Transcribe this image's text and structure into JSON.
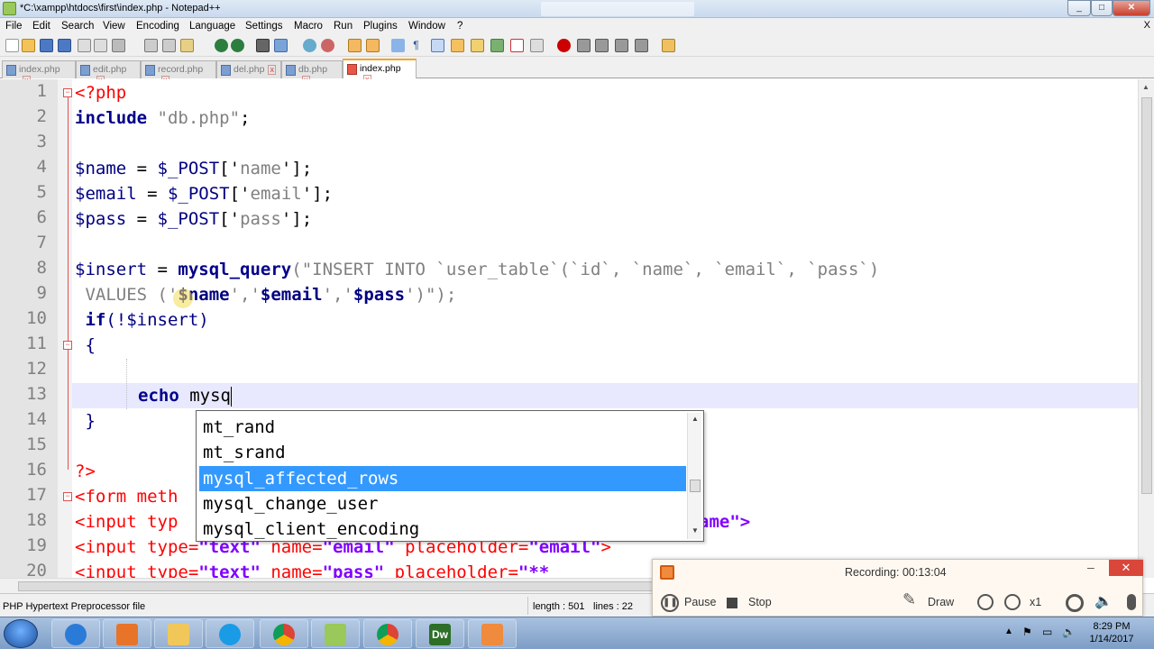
{
  "window": {
    "title": "*C:\\xampp\\htdocs\\first\\index.php - Notepad++",
    "min_label": "_",
    "max_label": "□",
    "close_label": "✕"
  },
  "menu": [
    "File",
    "Edit",
    "Search",
    "View",
    "Encoding",
    "Language",
    "Settings",
    "Macro",
    "Run",
    "Plugins",
    "Window",
    "?"
  ],
  "menu_close": "X",
  "tabs": [
    {
      "label": "index.php"
    },
    {
      "label": "edit.php"
    },
    {
      "label": "record.php"
    },
    {
      "label": "del.php"
    },
    {
      "label": "db.php"
    },
    {
      "label": "index.php",
      "active": true
    }
  ],
  "tab_close": "x",
  "editor": {
    "line_numbers": [
      "1",
      "2",
      "3",
      "4",
      "5",
      "6",
      "7",
      "8",
      "9",
      "10",
      "11",
      "12",
      "13",
      "14",
      "15",
      "16",
      "17",
      "18",
      "19",
      "20"
    ],
    "lines": {
      "l1": "<?php",
      "l2_kw": "include",
      "l2_str": " \"db.php\"",
      "l2_end": ";",
      "l4_var": "$name",
      "l4_op": " = ",
      "l4_post": "$_POST",
      "l4_idx": "['",
      "l4_key": "name",
      "l4_end": "'];",
      "l5_var": "$email",
      "l5_key": "email",
      "l6_var": "$pass",
      "l6_key": "pass",
      "l8_var": "$insert",
      "l8_fn": "mysql_query",
      "l8_str": "(\"INSERT INTO `user_table`(`id`, `name`, `email`, `pass`)",
      "l9_str": " VALUES ('",
      "l9_v1": "$name",
      "l9_s2": "','",
      "l9_v2": "$email",
      "l9_v3": "$pass",
      "l9_end": "')\");",
      "l10_kw": " if",
      "l10_rest": "(!$insert)",
      "l11": " {",
      "l13_kw": "echo",
      "l13_rest": " mysq",
      "l14": " }",
      "l16": "?>",
      "l17_tag": "<form",
      "l17_attr": " meth",
      "l18_tag": "<input",
      "l18_attr": " typ",
      "l18_tail": "ame\">",
      "l19_tag": "<input",
      "l19_a1": " type=",
      "l19_v1": "\"text\"",
      "l19_a2": " name=",
      "l19_v2": "\"email\"",
      "l19_a3": " placeholder=",
      "l19_v3": "\"email\"",
      "l19_end": ">",
      "l20_tag": "<input",
      "l20_a1": " type=",
      "l20_v1": "\"text\"",
      "l20_a2": " name=",
      "l20_v2": "\"pass\"",
      "l20_a3": " placeholder=",
      "l20_v3": "\"**"
    }
  },
  "autocomplete": {
    "items": [
      "mt_rand",
      "mt_srand",
      "mysql_affected_rows",
      "mysql_change_user",
      "mysql_client_encoding"
    ],
    "selected_index": 2
  },
  "status": {
    "filetype": "PHP Hypertext Preprocessor file",
    "length": "length : 501",
    "lines": "lines : 22"
  },
  "recorder": {
    "label": "Recording:",
    "time": "00:13:04",
    "pause": "Pause",
    "stop": "Stop",
    "draw": "Draw",
    "zoom": "x1",
    "min_label": "–",
    "close_label": "✕"
  },
  "taskbar": {
    "time": "8:29 PM",
    "date": "1/14/2017",
    "dw_label": "Dw"
  },
  "colors": {
    "keyword": "#00008b",
    "string": "#808080",
    "tag": "#ff0000",
    "attr_value": "#8000ff",
    "selection": "#3399ff",
    "current_line": "#e8e8ff"
  }
}
